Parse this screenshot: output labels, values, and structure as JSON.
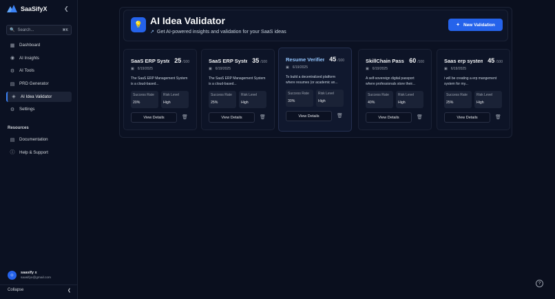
{
  "sidebar": {
    "brand": "SaaSifyX",
    "search_placeholder": "Search...",
    "search_shortcut": "⌘K",
    "items": [
      {
        "label": "Dashboard",
        "icon": "dashboard-icon"
      },
      {
        "label": "AI Insights",
        "icon": "insights-icon"
      },
      {
        "label": "AI Tools",
        "icon": "tools-icon"
      },
      {
        "label": "PRD Generator",
        "icon": "document-icon"
      },
      {
        "label": "AI Idea Validator",
        "icon": "validator-icon",
        "active": true
      },
      {
        "label": "Settings",
        "icon": "gear-icon"
      }
    ],
    "resources_label": "Resources",
    "resources": [
      {
        "label": "Documentation",
        "icon": "book-icon"
      },
      {
        "label": "Help & Support",
        "icon": "help-icon"
      }
    ],
    "user": {
      "name": "saasify x",
      "email": "saasifyx@gmail.com"
    },
    "collapse_label": "Collapse"
  },
  "header": {
    "title": "AI Idea Validator",
    "subtitle": "Get AI-powered insights and validation for your SaaS ideas",
    "new_button": "New Validation"
  },
  "cards": [
    {
      "title": "SaaS ERP System",
      "score": "25",
      "score_suffix": "/100",
      "date": "6/19/2025",
      "desc": "The SaaS ERP Management System is a cloud-based...",
      "success_label": "Success Rate",
      "success": "20%",
      "risk_label": "Risk Level",
      "risk": "High",
      "details": "View Details"
    },
    {
      "title": "SaaS ERP System",
      "score": "35",
      "score_suffix": "/100",
      "date": "6/19/2025",
      "desc": "The SaaS ERP Management System is a cloud-based...",
      "success_label": "Success Rate",
      "success": "25%",
      "risk_label": "Risk Level",
      "risk": "High",
      "details": "View Details"
    },
    {
      "title": "Resume Verifier Platform",
      "score": "45",
      "score_suffix": "/100",
      "date": "6/19/2025",
      "desc": "To build a decentralized platform where resumes (or academic an...",
      "success_label": "Success Rate",
      "success": "30%",
      "risk_label": "Risk Level",
      "risk": "High",
      "details": "View Details"
    },
    {
      "title": "SkillChain Passport",
      "score": "60",
      "score_suffix": "/100",
      "date": "6/19/2025",
      "desc": "A self-sovereign digital passport where professionals store their...",
      "success_label": "Success Rate",
      "success": "40%",
      "risk_label": "Risk Level",
      "risk": "High",
      "details": "View Details"
    },
    {
      "title": "Saas erp system",
      "score": "45",
      "score_suffix": "/100",
      "date": "6/19/2025",
      "desc": "i will be creating a erp mangement system for my...",
      "success_label": "Success Rate",
      "success": "25%",
      "risk_label": "Risk Level",
      "risk": "High",
      "details": "View Details"
    }
  ],
  "colors": {
    "accent": "#2563eb",
    "background": "#0a0f1e"
  }
}
